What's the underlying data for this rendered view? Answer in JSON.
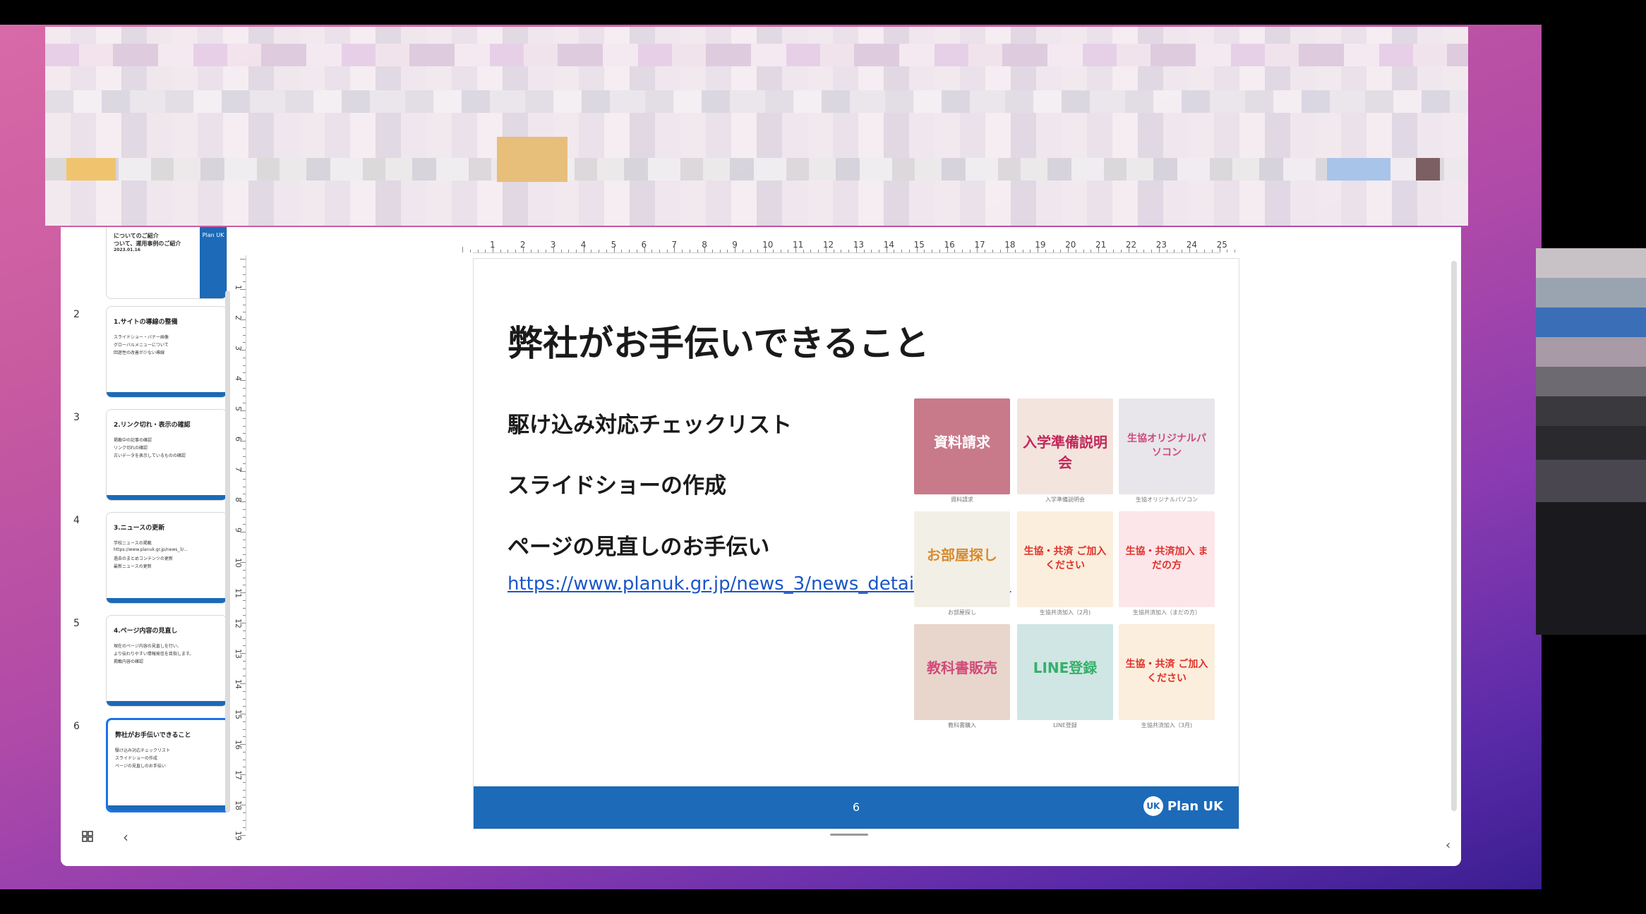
{
  "sidebar": {
    "thumbs": [
      {
        "num": "",
        "title": "",
        "lines": [
          "についてのご紹介",
          "ついて、運用事例のご紹介",
          "2023.01.16"
        ],
        "logo": "Plan UK"
      },
      {
        "num": "2",
        "title": "1.サイトの導線の整備",
        "lines": [
          "スライドショー・バナー画像",
          "グローバルメニューについて",
          "回遊性の改善が少ない導線"
        ]
      },
      {
        "num": "3",
        "title": "2.リンク切れ・表示の確認",
        "lines": [
          "掲載中の記事の確認",
          "リンク切れの確認",
          "古いデータを表示しているものの確認"
        ]
      },
      {
        "num": "4",
        "title": "3.ニュースの更新",
        "lines": [
          "学校ニュースの掲載",
          "https://www.planuk.gr.jp/news_3/...",
          "過去のまとめコンテンツの更新",
          "最新ニュースの更新"
        ]
      },
      {
        "num": "5",
        "title": "4.ページ内容の見直し",
        "lines": [
          "現在のページ内容の見直しを行い、",
          "より伝わりやすい情報発信を目指します。",
          "掲載内容の確認"
        ]
      },
      {
        "num": "6",
        "title": "弊社がお手伝いできること",
        "lines": [
          "駆け込み対応チェックリスト",
          "スライドショーの作成",
          "ページの見直しのお手伝い"
        ]
      }
    ]
  },
  "rulers": {
    "horizontal": [
      "1",
      "2",
      "3",
      "4",
      "5",
      "6",
      "7",
      "8",
      "9",
      "10",
      "11",
      "12",
      "13",
      "14",
      "15",
      "16",
      "17",
      "18",
      "19",
      "20",
      "21",
      "22",
      "23",
      "24",
      "25"
    ],
    "vertical": [
      "1",
      "2",
      "3",
      "4",
      "5",
      "6",
      "7",
      "8",
      "9",
      "10",
      "11",
      "12",
      "13",
      "14",
      "15",
      "16",
      "17",
      "18",
      "19"
    ]
  },
  "slide": {
    "title": "弊社がお手伝いできること",
    "items": [
      "駆け込み対応チェックリスト",
      "スライドショーの作成",
      "ページの見直しのお手伝い"
    ],
    "link": "https://www.planuk.gr.jp/news_3/news_detail_737.html",
    "page_number": "6",
    "logo": "Plan UK",
    "tiles": [
      {
        "label": "資料請求",
        "caption": "資料請求",
        "bg": "#c87a8a",
        "fg": "#ffffff"
      },
      {
        "label": "入学準備説明会",
        "caption": "入学準備説明会",
        "bg": "#f3e4de",
        "fg": "#c0285a"
      },
      {
        "label": "生協オリジナルパソコン",
        "caption": "生協オリジナルパソコン",
        "bg": "#e8e6ea",
        "fg": "#d04a7a"
      },
      {
        "label": "お部屋探し",
        "caption": "お部屋探し",
        "bg": "#f2f0e6",
        "fg": "#d88a30"
      },
      {
        "label": "生協・共済 ご加入ください",
        "caption": "生協共済加入（2月)",
        "bg": "#fbeedc",
        "fg": "#e0302a"
      },
      {
        "label": "生協・共済加入 まだの方",
        "caption": "生協共済加入（まだの方）",
        "bg": "#fde6ea",
        "fg": "#e0302a"
      },
      {
        "label": "教科書販売",
        "caption": "教科書購入",
        "bg": "#e8d6cc",
        "fg": "#d04a7a"
      },
      {
        "label": "LINE登録",
        "caption": "LINE登録",
        "bg": "#cfe6e4",
        "fg": "#36b06a"
      },
      {
        "label": "生協・共済 ご加入ください",
        "caption": "生協共済加入（3月)",
        "bg": "#fbeedc",
        "fg": "#e0302a"
      }
    ]
  },
  "colors": {
    "accent": "#1c6ab8",
    "selected": "#1a73e8",
    "link": "#1a56c8"
  },
  "icons": {
    "grid": "grid-icon",
    "collapse": "chevron-left-icon",
    "expand": "chevron-right-icon"
  }
}
